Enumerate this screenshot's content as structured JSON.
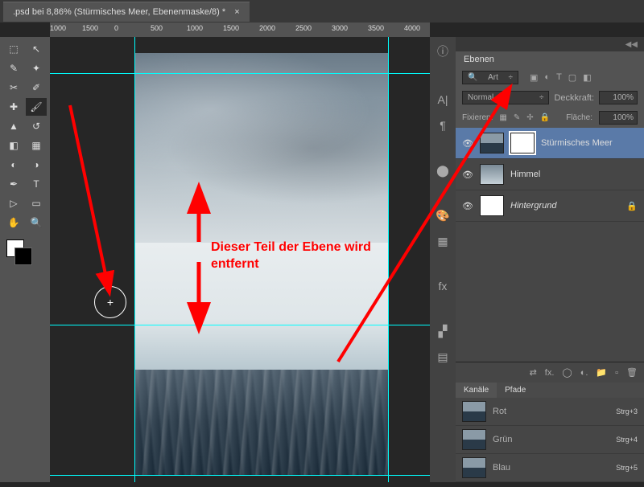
{
  "tab": {
    "title": ".psd bei 8,86% (Stürmisches Meer, Ebenenmaske/8) *"
  },
  "ruler": [
    "1000",
    "1500",
    "0",
    "500",
    "1000",
    "1500",
    "2000",
    "2500",
    "3000",
    "3500",
    "4000"
  ],
  "annotation": {
    "line1": "Dieser Teil der Ebene wird",
    "line2": "entfernt"
  },
  "panels": {
    "layers_tab": "Ebenen",
    "kind_label": "Art",
    "blend_mode": "Normal",
    "opacity_label": "Deckkraft:",
    "opacity_value": "100%",
    "lock_label": "Fixieren:",
    "fill_label": "Fläche:",
    "fill_value": "100%",
    "layers": [
      {
        "name": "Stürmisches Meer"
      },
      {
        "name": "Himmel"
      },
      {
        "name": "Hintergrund"
      }
    ],
    "channels_tab": "Kanäle",
    "paths_tab": "Pfade",
    "channels": [
      {
        "name": "Rot",
        "shortcut": "Strg+3"
      },
      {
        "name": "Grün",
        "shortcut": "Strg+4"
      },
      {
        "name": "Blau",
        "shortcut": "Strg+5"
      }
    ]
  }
}
